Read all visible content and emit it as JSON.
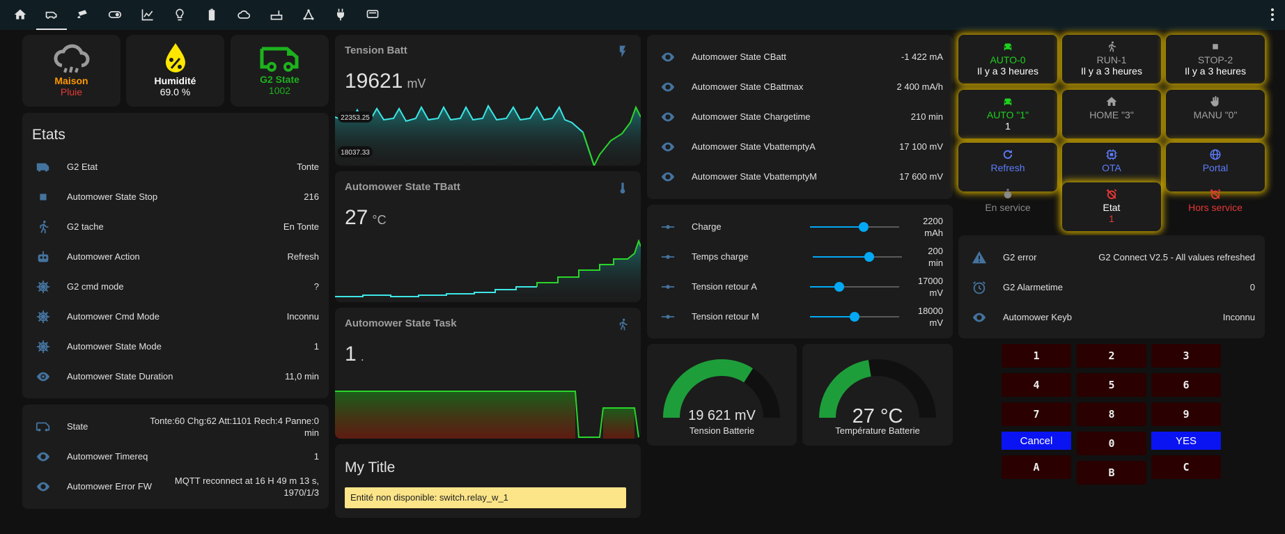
{
  "nav": {
    "icons": [
      "home-icon",
      "car-icon",
      "security-camera-icon",
      "toggle-icon",
      "chart-line-icon",
      "lightbulb-icon",
      "battery-icon",
      "cloud-icon",
      "router-icon",
      "graph-icon",
      "power-plug-icon",
      "rv-icon"
    ],
    "active_index": 1
  },
  "tiles": [
    {
      "name": "Maison",
      "state": "Pluie",
      "name_color": "#ff9800",
      "state_color": "#e53935",
      "icon": "weather-rain-icon"
    },
    {
      "name": "Humidité",
      "state": "69.0 %",
      "name_color": "#ffffff",
      "state_color": "#ffffff",
      "icon": "water-percent-icon"
    },
    {
      "name": "G2 State",
      "state": "1002",
      "name_color": "#1db21d",
      "state_color": "#1db21d",
      "icon": "rv-truck-icon"
    }
  ],
  "etats": {
    "title": "Etats",
    "rows": [
      {
        "label": "G2 Etat",
        "value": "Tonte",
        "icon": "rv-truck-icon"
      },
      {
        "label": "Automower State Stop",
        "value": "216",
        "icon": "stop-icon"
      },
      {
        "label": "G2 tache",
        "value": "En Tonte",
        "icon": "run-icon"
      },
      {
        "label": "Automower Action",
        "value": "Refresh",
        "icon": "robot-icon"
      },
      {
        "label": "G2 cmd mode",
        "value": "?",
        "icon": "ship-wheel-icon"
      },
      {
        "label": "Automower Cmd Mode",
        "value": "Inconnu",
        "icon": "ship-wheel-icon"
      },
      {
        "label": "Automower State Mode",
        "value": "1",
        "icon": "ship-wheel-icon"
      },
      {
        "label": "Automower State Duration",
        "value": "11,0 min",
        "icon": "eye-icon"
      }
    ]
  },
  "state_card": {
    "rows": [
      {
        "label": "State",
        "value_line1": "Tonte:60 Chg:62 Att:1101 Rech:4 Panne:0",
        "value_line2": "min",
        "icon": "rv-truck-icon"
      },
      {
        "label": "Automower Timereq",
        "value_line1": "1",
        "value_line2": "",
        "icon": "eye-icon"
      },
      {
        "label": "Automower Error FW",
        "value_line1": "MQTT reconnect at 16 H 49 m 13 s,",
        "value_line2": "1970/1/3",
        "icon": "eye-icon"
      }
    ]
  },
  "sensors": [
    {
      "title": "Tension Batt",
      "value": "19621",
      "unit": "mV",
      "icon": "flash-icon",
      "label_max": "22353.25",
      "label_min": "18037.33"
    },
    {
      "title": "Automower State TBatt",
      "value": "27",
      "unit": "°C",
      "icon": "thermometer-icon"
    },
    {
      "title": "Automower State Task",
      "value": "1",
      "unit": ".",
      "icon": "run-icon"
    }
  ],
  "title_card": {
    "title": "My Title",
    "warning": "Entité non disponible: switch.relay_w_1"
  },
  "automower_state": {
    "rows": [
      {
        "label": "Automower State CBatt",
        "value": "-1 422 mA"
      },
      {
        "label": "Automower State CBattmax",
        "value": "2 400 mA/h"
      },
      {
        "label": "Automower State Chargetime",
        "value": "210 min"
      },
      {
        "label": "Automower State VbattemptyA",
        "value": "17 100 mV"
      },
      {
        "label": "Automower State VbattemptyM",
        "value": "17 600 mV"
      }
    ]
  },
  "sliders": {
    "rows": [
      {
        "label": "Charge",
        "value_line1": "2200",
        "value_line2": "mAh",
        "fraction": 0.6
      },
      {
        "label": "Temps charge",
        "value_line1": "200",
        "value_line2": "min",
        "fraction": 0.63
      },
      {
        "label": "Tension retour A",
        "value_line1": "17000",
        "value_line2": "mV",
        "fraction": 0.33
      },
      {
        "label": "Tension retour M",
        "value_line1": "18000",
        "value_line2": "mV",
        "fraction": 0.5
      }
    ]
  },
  "gauges": [
    {
      "value": "19 621 mV",
      "name": "Tension Batterie",
      "fraction": 0.68,
      "color": "#1e9e3a"
    },
    {
      "value": "27 °C",
      "name": "Température Batterie",
      "fraction": 0.45,
      "color": "#1e9e3a"
    }
  ],
  "buttons": [
    {
      "l1": "AUTO-0",
      "l2": "Il y a 3 heures",
      "c1": "#1ed21e",
      "c2": "#ffffff",
      "icon": "car-icon",
      "icon_color": "#1ed21e",
      "glow": true
    },
    {
      "l1": "RUN-1",
      "l2": "Il y a 3 heures",
      "c1": "#a0a0a0",
      "c2": "#ffffff",
      "icon": "run-icon",
      "icon_color": "#a0a0a0",
      "glow": true
    },
    {
      "l1": "STOP-2",
      "l2": "Il y a 3 heures",
      "c1": "#a0a0a0",
      "c2": "#ffffff",
      "icon": "stop-icon",
      "icon_color": "#a0a0a0",
      "glow": true
    },
    {
      "l1": "AUTO \"1\"",
      "l2": "1",
      "c1": "#1ed21e",
      "c2": "#ffffff",
      "icon": "car-icon",
      "icon_color": "#1ed21e",
      "glow": true
    },
    {
      "l1": "HOME \"3\"",
      "l2": "",
      "c1": "#a0a0a0",
      "c2": "#ffffff",
      "icon": "home-icon",
      "icon_color": "#a0a0a0",
      "glow": true
    },
    {
      "l1": "MANU \"0\"",
      "l2": "",
      "c1": "#a0a0a0",
      "c2": "#ffffff",
      "icon": "hand-icon",
      "icon_color": "#a0a0a0",
      "glow": true
    },
    {
      "l1": "Refresh",
      "l2": "",
      "c1": "#5c7cfa",
      "c2": "#ffffff",
      "icon": "refresh-icon",
      "icon_color": "#5c7cfa",
      "glow": true
    },
    {
      "l1": "OTA",
      "l2": "",
      "c1": "#5c7cfa",
      "c2": "#ffffff",
      "icon": "chip-icon",
      "icon_color": "#5c7cfa",
      "glow": true
    },
    {
      "l1": "Portal",
      "l2": "",
      "c1": "#5c7cfa",
      "c2": "#ffffff",
      "icon": "globe-icon",
      "icon_color": "#5c7cfa",
      "glow": true
    },
    {
      "l1": "En service",
      "l2": "",
      "c1": "#8a8a8a",
      "c2": "#ffffff",
      "icon": "timer-icon",
      "icon_color": "#8a8a8a",
      "glow": false
    },
    {
      "l1": "Etat",
      "l2": "1",
      "c1": "#ffffff",
      "c2": "#e53935",
      "icon": "alarm-off-icon",
      "icon_color": "#e53935",
      "glow": true
    },
    {
      "l1": "Hors service",
      "l2": "",
      "c1": "#e53935",
      "c2": "#ffffff",
      "icon": "alarm-off-icon",
      "icon_color": "#e53935",
      "glow": false
    }
  ],
  "error_card": {
    "rows": [
      {
        "label": "G2 error",
        "value": "G2 Connect V2.5 - All values refreshed",
        "icon": "alert-icon"
      },
      {
        "label": "G2 Alarmetime",
        "value": "0",
        "icon": "alarm-clock-icon"
      },
      {
        "label": "Automower Keyb",
        "value": "Inconnu",
        "icon": "eye-icon"
      }
    ]
  },
  "keypad": {
    "keys": [
      "1",
      "2",
      "3",
      "4",
      "5",
      "6",
      "7",
      "8",
      "9"
    ],
    "cancel": "Cancel",
    "zero": "0",
    "yes": "YES",
    "a": "A",
    "b": "B",
    "c": "C"
  },
  "colors": {
    "accent": "#03a9f4",
    "icon": "#44739e",
    "background": "#111111",
    "card": "#1c1c1c",
    "glow": "#c8a400",
    "warning_bg": "#fce588"
  }
}
